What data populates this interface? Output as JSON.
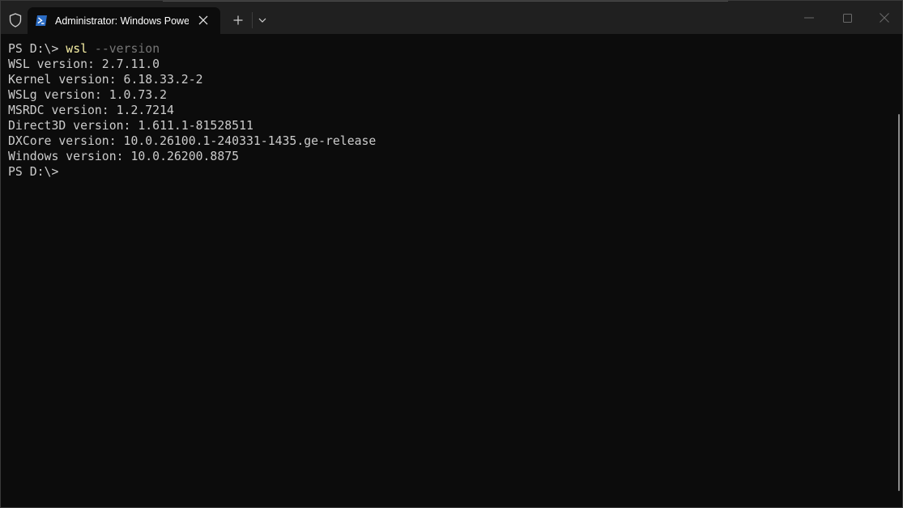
{
  "tab": {
    "title": "Administrator: Windows PowerShell"
  },
  "terminal": {
    "prompt": "PS D:\\> ",
    "command": "wsl",
    "argument": " --version",
    "output": [
      "WSL version: 2.7.11.0",
      "Kernel version: 6.18.33.2-2",
      "WSLg version: 1.0.73.2",
      "MSRDC version: 1.2.7214",
      "Direct3D version: 1.611.1-81528511",
      "DXCore version: 10.0.26100.1-240331-1435.ge-release",
      "Windows version: 10.0.26200.8875"
    ],
    "final_prompt": "PS D:\\>"
  },
  "icons": {
    "shield": "shield-icon",
    "powershell": "powershell-icon",
    "close_tab": "close-icon",
    "new_tab": "plus-icon",
    "dropdown": "chevron-down-icon",
    "minimize": "minimize-icon",
    "maximize": "maximize-icon",
    "close_window": "close-icon"
  },
  "colors": {
    "background": "#0c0c0c",
    "titlebar": "#202020",
    "text": "#cccccc",
    "command": "#f9f1a5",
    "parameter": "#767676",
    "powershell_icon": "#2b6cc4"
  }
}
